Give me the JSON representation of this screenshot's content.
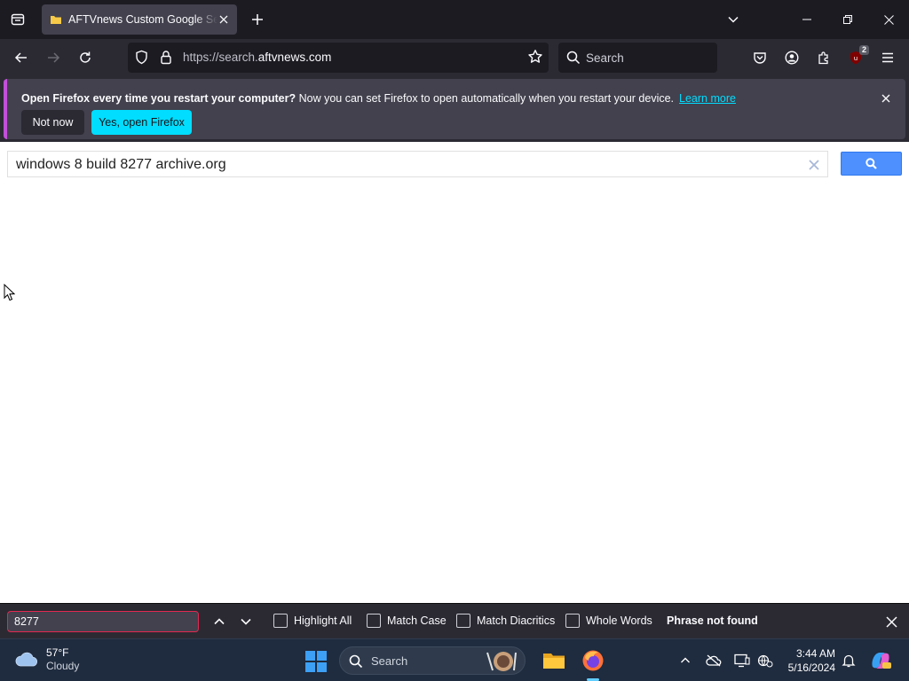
{
  "tabbar": {
    "tab_title": "AFTVnews Custom Google Search"
  },
  "navbar": {
    "url_prefix": "https://search.",
    "url_host": "aftvnews.com",
    "search_placeholder": "Search",
    "extension_badge": "2"
  },
  "notification": {
    "bold_text": "Open Firefox every time you restart your computer?",
    "body_text": " Now you can set Firefox to open automatically when you restart your device.",
    "link_text": "Learn more",
    "not_now_label": "Not now",
    "yes_label": "Yes, open Firefox"
  },
  "page": {
    "search_query": "windows 8 build 8277 archive.org",
    "search_button_color": "#4d90fe"
  },
  "findbar": {
    "query": "8277",
    "options": [
      "Highlight All",
      "Match Case",
      "Match Diacritics",
      "Whole Words"
    ],
    "status": "Phrase not found"
  },
  "taskbar": {
    "temperature": "57°F",
    "condition": "Cloudy",
    "search_placeholder": "Search",
    "time": "3:44 AM",
    "date": "5/16/2024"
  },
  "colors": {
    "toolbar_bg": "#2b2a33",
    "tabbar_bg": "#1c1b22",
    "accent_cyan": "#00ddff",
    "find_error_border": "#e22850"
  }
}
